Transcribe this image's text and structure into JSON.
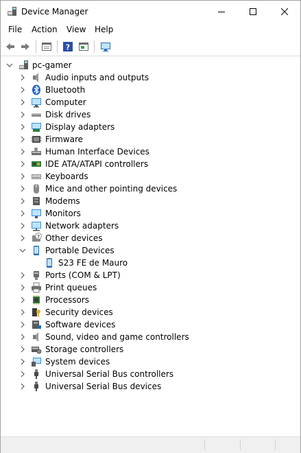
{
  "window": {
    "title": "Device Manager"
  },
  "menubar": {
    "file": "File",
    "action": "Action",
    "view": "View",
    "help": "Help"
  },
  "toolbar": {
    "icons": [
      "back-icon",
      "forward-icon",
      "properties-icon",
      "help-icon",
      "update-driver-icon",
      "scan-hardware-icon"
    ]
  },
  "tree": {
    "root": "pc-gamer",
    "categories": [
      {
        "label": "Audio inputs and outputs",
        "icon": "speaker-icon",
        "expanded": false
      },
      {
        "label": "Bluetooth",
        "icon": "bluetooth-icon",
        "expanded": false
      },
      {
        "label": "Computer",
        "icon": "computer-icon",
        "expanded": false
      },
      {
        "label": "Disk drives",
        "icon": "disk-drive-icon",
        "expanded": false
      },
      {
        "label": "Display adapters",
        "icon": "display-adapter-icon",
        "expanded": false
      },
      {
        "label": "Firmware",
        "icon": "firmware-icon",
        "expanded": false
      },
      {
        "label": "Human Interface Devices",
        "icon": "hid-icon",
        "expanded": false
      },
      {
        "label": "IDE ATA/ATAPI controllers",
        "icon": "ide-controller-icon",
        "expanded": false
      },
      {
        "label": "Keyboards",
        "icon": "keyboard-icon",
        "expanded": false
      },
      {
        "label": "Mice and other pointing devices",
        "icon": "mouse-icon",
        "expanded": false
      },
      {
        "label": "Modems",
        "icon": "modem-icon",
        "expanded": false
      },
      {
        "label": "Monitors",
        "icon": "monitor-icon",
        "expanded": false
      },
      {
        "label": "Network adapters",
        "icon": "network-adapter-icon",
        "expanded": false
      },
      {
        "label": "Other devices",
        "icon": "other-devices-icon",
        "expanded": false
      },
      {
        "label": "Portable Devices",
        "icon": "portable-device-icon",
        "expanded": true,
        "children": [
          {
            "label": "S23 FE de Mauro",
            "icon": "phone-icon"
          }
        ]
      },
      {
        "label": "Ports (COM & LPT)",
        "icon": "port-icon",
        "expanded": false
      },
      {
        "label": "Print queues",
        "icon": "printer-icon",
        "expanded": false
      },
      {
        "label": "Processors",
        "icon": "processor-icon",
        "expanded": false
      },
      {
        "label": "Security devices",
        "icon": "security-device-icon",
        "expanded": false
      },
      {
        "label": "Software devices",
        "icon": "software-device-icon",
        "expanded": false
      },
      {
        "label": "Sound, video and game controllers",
        "icon": "sound-controller-icon",
        "expanded": false
      },
      {
        "label": "Storage controllers",
        "icon": "storage-controller-icon",
        "expanded": false
      },
      {
        "label": "System devices",
        "icon": "system-device-icon",
        "expanded": false
      },
      {
        "label": "Universal Serial Bus controllers",
        "icon": "usb-icon",
        "expanded": false
      },
      {
        "label": "Universal Serial Bus devices",
        "icon": "usb-icon",
        "expanded": false
      }
    ]
  },
  "colors": {
    "accent": "#0078d7",
    "selection": "#cce8ff",
    "chevron": "#5a5a5a"
  }
}
